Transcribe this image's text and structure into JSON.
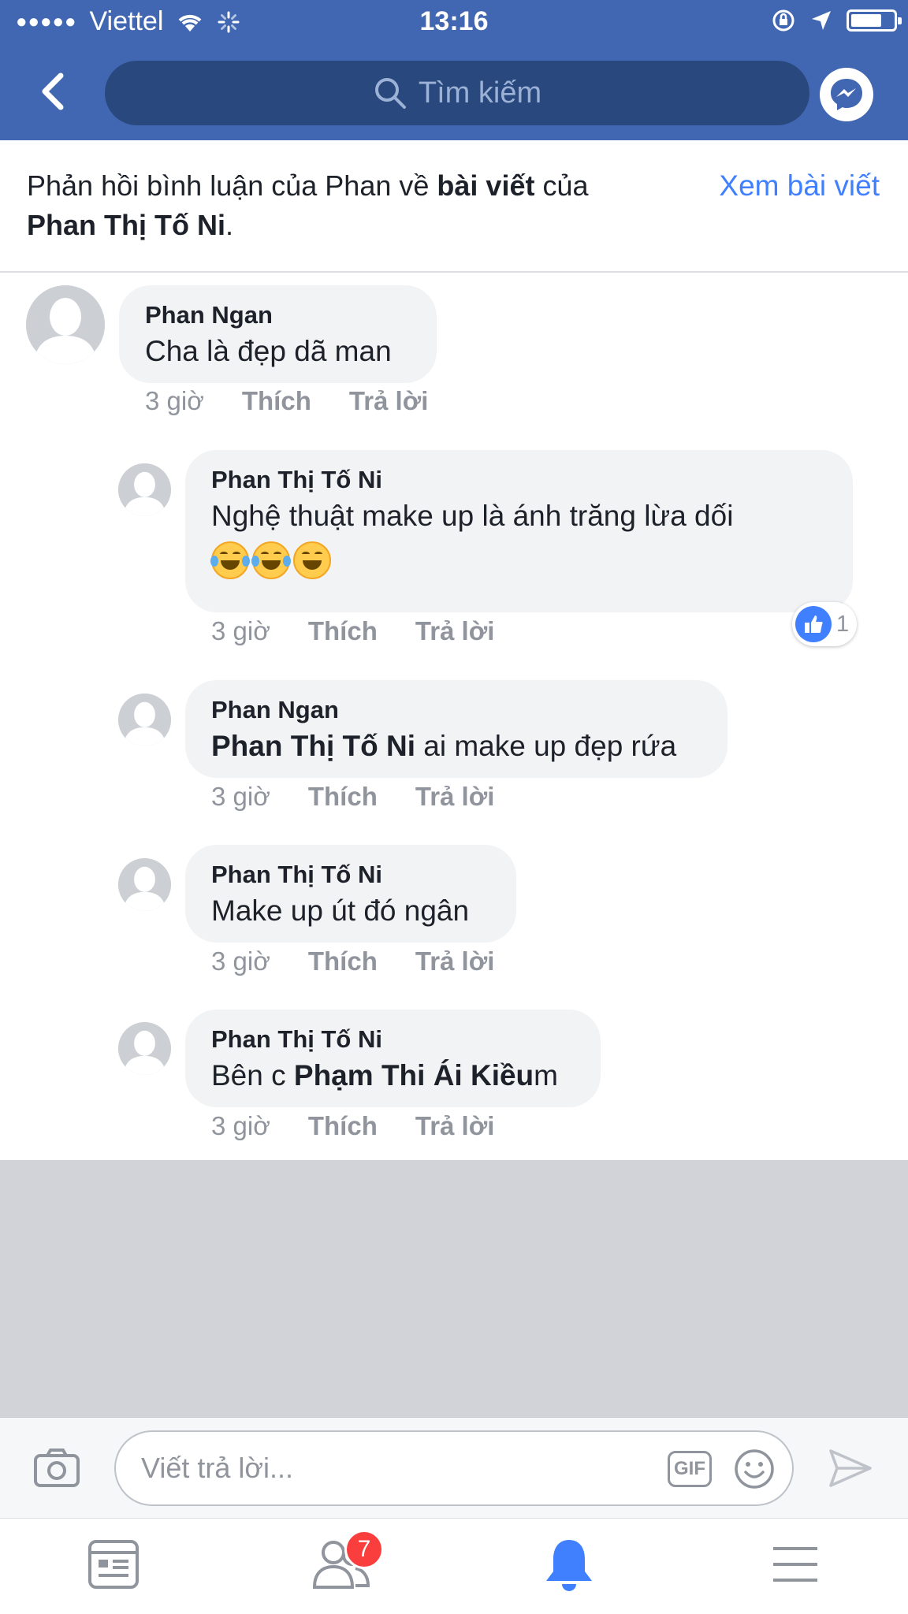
{
  "status_bar": {
    "signal": "●●●●●",
    "carrier": "Viettel",
    "time": "13:16"
  },
  "search": {
    "placeholder": "Tìm kiếm"
  },
  "context": {
    "part1": "Phản hồi bình luận của Phan về ",
    "link1": "bài viết",
    "part2": " của ",
    "owner": "Phan Thị Tố Ni",
    "part3": ".",
    "view_post": "Xem bài viết"
  },
  "comments": [
    {
      "author": "Phan Ngan",
      "text": "Cha là đẹp dã man",
      "time": "3 giờ",
      "like": "Thích",
      "reply": "Trả lời"
    },
    {
      "author": "Phan Thị Tố Ni",
      "text": "Nghệ thuật make up là ánh trăng lừa dối",
      "emojis": [
        "face-with-tears-of-joy",
        "face-with-tears-of-joy",
        "grinning-face"
      ],
      "reactions": "1",
      "time": "3 giờ",
      "like": "Thích",
      "reply": "Trả lời"
    },
    {
      "author": "Phan Ngan",
      "mention": "Phan Thị Tố Ni",
      "text": " ai make up đẹp rứa",
      "time": "3 giờ",
      "like": "Thích",
      "reply": "Trả lời"
    },
    {
      "author": "Phan Thị Tố Ni",
      "text": "Make up út đó ngân",
      "time": "3 giờ",
      "like": "Thích",
      "reply": "Trả lời"
    },
    {
      "author": "Phan Thị Tố Ni",
      "text_before": "Bên c ",
      "mention": "Phạm Thi Ái Kiều",
      "text_after": "m",
      "time": "3 giờ",
      "like": "Thích",
      "reply": "Trả lời"
    }
  ],
  "composer": {
    "placeholder": "Viết trả lời...",
    "gif": "GIF"
  },
  "tabbar": {
    "items": [
      "news-feed-icon",
      "friend-requests-icon",
      "notifications-icon",
      "menu-icon"
    ],
    "friend_requests_badge": "7"
  },
  "colors": {
    "facebook_blue": "#4267b2",
    "link_blue": "#4080ff",
    "bubble_gray": "#f2f3f5",
    "meta_gray": "#90949c",
    "badge_red": "#fa3e3e"
  }
}
